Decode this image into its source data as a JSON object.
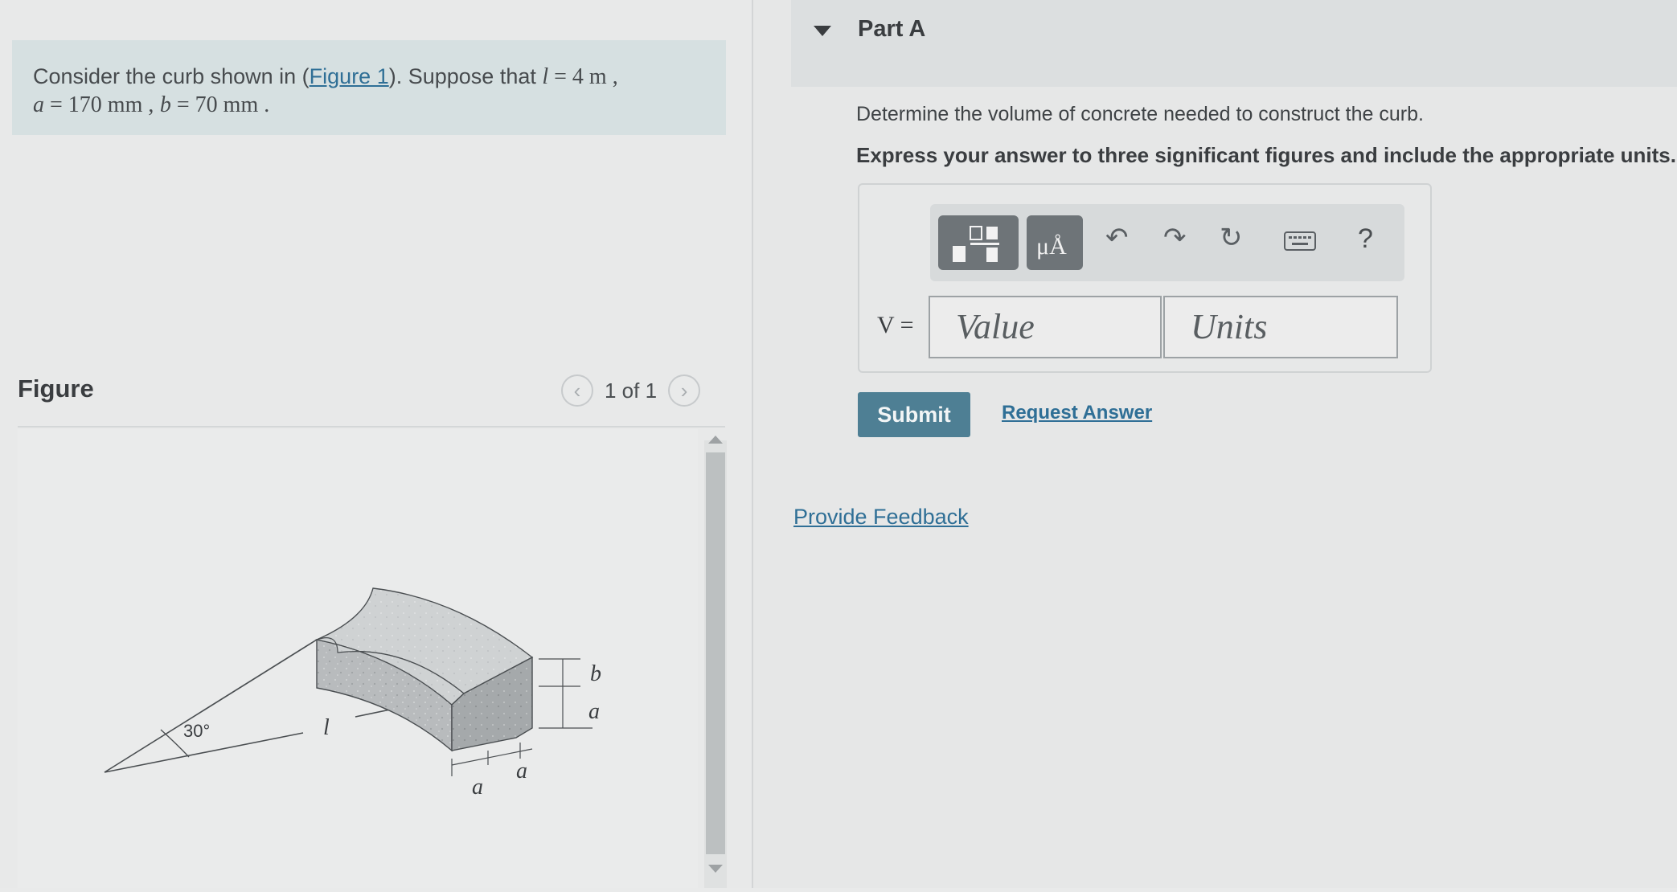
{
  "problem": {
    "text_prefix": "Consider the curb shown in (",
    "figure_link": "Figure 1",
    "text_mid": "). Suppose that ",
    "l_var": "l",
    "l_value": " = 4  m ,",
    "a_var": "a",
    "a_value": " = 170  mm ,",
    "b_var": "b",
    "b_value": " = 70  mm ."
  },
  "figure": {
    "label": "Figure",
    "pager_text": "1 of 1",
    "diagram_labels": {
      "angle": "30°",
      "l": "l",
      "b": "b",
      "a_side": "a",
      "a_bottom_right": "a",
      "a_bottom_left": "a"
    }
  },
  "part": {
    "title": "Part A",
    "question": "Determine the volume of concrete needed to construct the curb.",
    "instruction": "Express your answer to three significant figures and include the appropriate units.",
    "variable_label": "V =",
    "value_placeholder": "Value",
    "units_placeholder": "Units",
    "toolbar": {
      "mu_label": "μÅ",
      "help_label": "?"
    },
    "submit_label": "Submit",
    "request_answer_label": "Request Answer"
  },
  "feedback_label": "Provide Feedback",
  "colors": {
    "link": "#2f6f96",
    "submit_bg": "#4e7f94",
    "statement_bg": "#d6e0e1"
  }
}
